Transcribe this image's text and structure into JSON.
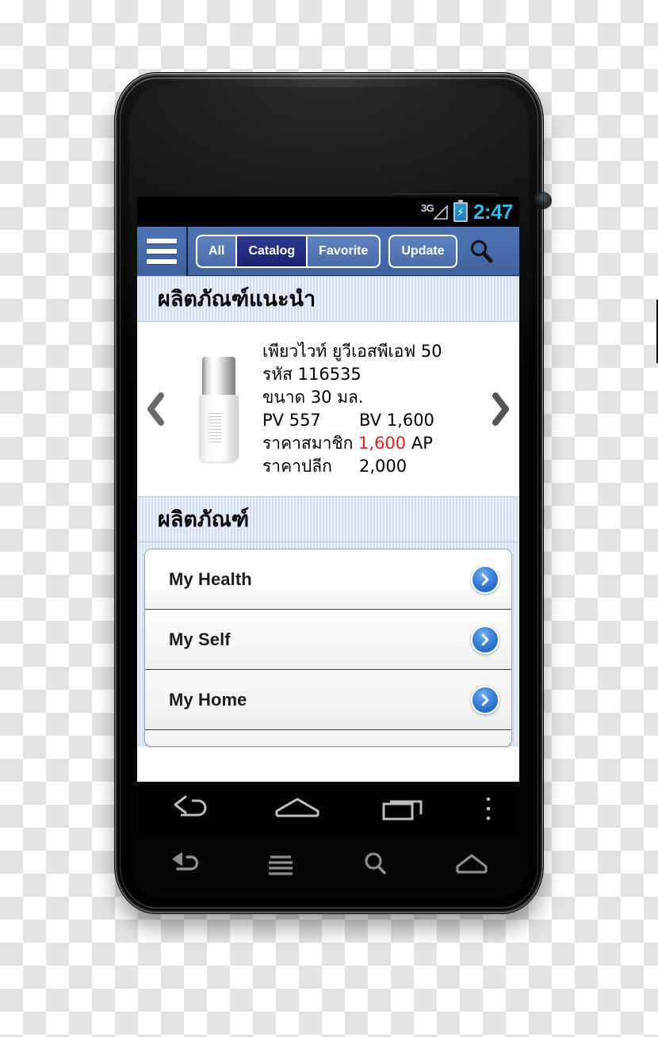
{
  "statusbar": {
    "network": "3G",
    "battery_icon": "battery-charging-icon",
    "time": "2:47"
  },
  "appbar": {
    "menu_icon": "hamburger-menu-icon",
    "search_icon": "search-icon",
    "tabs": [
      {
        "label": "All",
        "active": false
      },
      {
        "label": "Catalog",
        "active": true
      },
      {
        "label": "Favorite",
        "active": false
      }
    ],
    "update_label": "Update"
  },
  "featured": {
    "section_title": "ผลิตภัณฑ์แนะนำ",
    "prev_icon": "chevron-left-icon",
    "next_icon": "chevron-right-icon",
    "product": {
      "name": "เพียวไวท์ ยูวีเอสพีเอฟ 50",
      "code_line": "รหัส 116535",
      "size_line": "ขนาด 30 มล.",
      "pv": "PV 557",
      "bv": "BV 1,600",
      "member_price_label": "ราคาสมาชิก",
      "member_price_value": "1,600",
      "member_price_unit": "AP",
      "retail_price_label": "ราคาปลีก",
      "retail_price_value": "2,000",
      "image_icon": "product-bottle-image"
    }
  },
  "catalog": {
    "section_title": "ผลิตภัณฑ์",
    "items": [
      {
        "label": "My Health",
        "chevron_icon": "chevron-right-circle-icon"
      },
      {
        "label": "My Self",
        "chevron_icon": "chevron-right-circle-icon"
      },
      {
        "label": "My Home",
        "chevron_icon": "chevron-right-circle-icon"
      },
      {
        "label": "",
        "chevron_icon": "chevron-right-circle-icon"
      }
    ]
  },
  "navbar": {
    "back_icon": "back-arrow-icon",
    "home_icon": "home-icon",
    "recents_icon": "recent-apps-icon",
    "overflow_icon": "overflow-menu-icon"
  },
  "capkeys": {
    "back_icon": "back-arrow-icon",
    "menu_icon": "menu-lines-icon",
    "search_icon": "search-icon",
    "home_icon": "home-icon"
  },
  "colors": {
    "appbar": "#4e74b6",
    "tab_active": "#232d80",
    "section_stripe": "#cfdcf2",
    "price_red": "#e8201c",
    "status_time": "#33b5e5",
    "chevron_blue": "#3d86dd"
  }
}
